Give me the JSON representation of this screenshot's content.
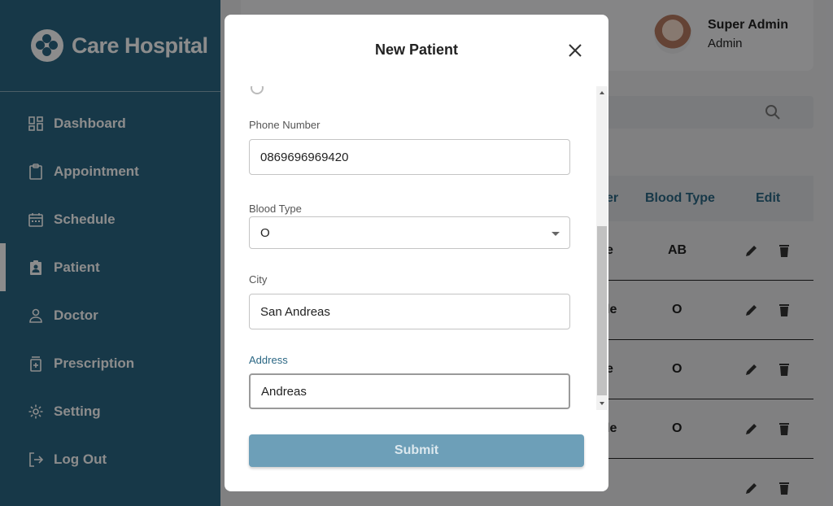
{
  "brand": {
    "name": "Care Hospital"
  },
  "sidebar": {
    "items": [
      {
        "label": "Dashboard",
        "icon": "dashboard-icon"
      },
      {
        "label": "Appointment",
        "icon": "clipboard-icon"
      },
      {
        "label": "Schedule",
        "icon": "calendar-icon"
      },
      {
        "label": "Patient",
        "icon": "patient-badge-icon",
        "active": true
      },
      {
        "label": "Doctor",
        "icon": "person-icon"
      },
      {
        "label": "Prescription",
        "icon": "medicine-icon"
      },
      {
        "label": "Setting",
        "icon": "gear-icon"
      },
      {
        "label": "Log Out",
        "icon": "logout-icon"
      }
    ]
  },
  "user": {
    "name": "Super Admin",
    "role": "Admin"
  },
  "table": {
    "headers": {
      "gender_partial": "er",
      "blood_type": "Blood Type",
      "edit": "Edit"
    },
    "rows": [
      {
        "gender_partial": "e",
        "blood_type": "AB"
      },
      {
        "gender_partial": "le",
        "blood_type": "O"
      },
      {
        "gender_partial": "e",
        "blood_type": "O"
      },
      {
        "gender_partial": "le",
        "blood_type": "O"
      }
    ]
  },
  "modal": {
    "title": "New Patient",
    "fields": {
      "phone": {
        "label": "Phone Number",
        "value": "0869696969420"
      },
      "blood_type": {
        "label": "Blood Type",
        "value": "O"
      },
      "city": {
        "label": "City",
        "value": "San Andreas"
      },
      "address": {
        "label": "Address",
        "value": "Andreas"
      }
    },
    "submit_label": "Submit"
  },
  "colors": {
    "primary": "#2b6784",
    "submit": "#6d9fb8",
    "overlay": "rgba(0,0,0,0.45)"
  }
}
